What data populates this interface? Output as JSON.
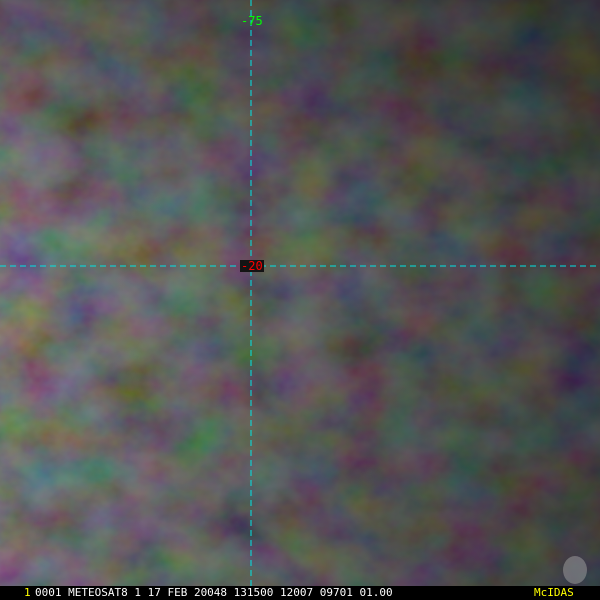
{
  "image": {
    "satellite": "METEOSAT8",
    "palette": {
      "base": "#1c1c1c",
      "cloud": "#3a3a3a",
      "dark": "#121212"
    }
  },
  "grid": {
    "line_color": "#00e5e5",
    "latitude_label": "-20",
    "longitude_label": "-75"
  },
  "status_bar": {
    "frame": "1",
    "text": "0001 METEOSAT8    1 17 FEB 20048 131500 12007 09701 01.00",
    "brand": "McIDAS"
  }
}
